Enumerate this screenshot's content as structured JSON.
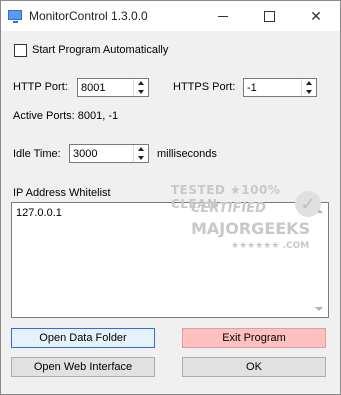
{
  "window": {
    "title": "MonitorControl 1.3.0.0",
    "icons": {
      "app": "monitor-icon",
      "minimize": "minimize-icon",
      "maximize": "maximize-icon",
      "close": "close-icon"
    }
  },
  "settings": {
    "start_auto_label": "Start Program Automatically",
    "start_auto_checked": false,
    "http_port_label": "HTTP Port:",
    "http_port_value": "8001",
    "https_port_label": "HTTPS Port:",
    "https_port_value": "-1",
    "active_ports_text": "Active Ports: 8001, -1",
    "idle_time_label": "Idle Time:",
    "idle_time_value": "3000",
    "idle_time_unit": "milliseconds",
    "whitelist_label": "IP Address Whitelist",
    "whitelist_value": "127.0.0.1"
  },
  "buttons": {
    "open_data_folder": "Open Data Folder",
    "exit_program": "Exit Program",
    "open_web_interface": "Open Web Interface",
    "ok": "OK"
  },
  "watermark": {
    "line1": "TESTED ★100% CLEAN",
    "line2": "CERTIFIED",
    "line3": "MAJORGEEKS",
    "line4": "★★★★★★ .COM"
  },
  "colors": {
    "accent": "#2f6fd6",
    "exit_button": "#ffc0c0"
  }
}
